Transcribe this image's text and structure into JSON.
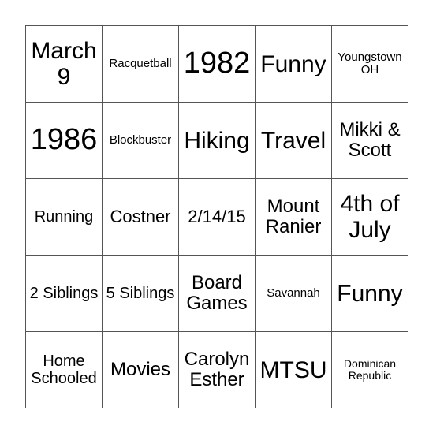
{
  "card": {
    "rows": [
      [
        "March 9",
        "Racquetball",
        "1982",
        "Funny",
        "Youngstown OH"
      ],
      [
        "1986",
        "Blockbuster",
        "Hiking",
        "Travel",
        "Mikki & Scott"
      ],
      [
        "Running",
        "Costner",
        "2/14/15",
        "Mount Ranier",
        "4th of July"
      ],
      [
        "2 Siblings",
        "5 Siblings",
        "Board Games",
        "Savannah",
        "Funny"
      ],
      [
        "Home Schooled",
        "Movies",
        "Carolyn Esther",
        "MTSU",
        "Dominican Republic"
      ]
    ]
  }
}
